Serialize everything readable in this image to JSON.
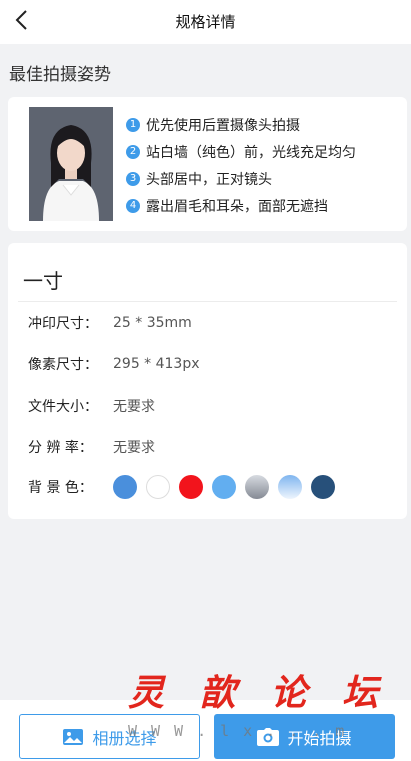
{
  "topbar": {
    "title": "规格详情",
    "back_icon": "chevron-left-icon"
  },
  "section": {
    "heading": "最佳拍摄姿势"
  },
  "tips": [
    {
      "num": "1",
      "text": "优先使用后置摄像头拍摄"
    },
    {
      "num": "2",
      "text": "站白墙（纯色）前，光线充足均匀"
    },
    {
      "num": "3",
      "text": "头部居中，正对镜头"
    },
    {
      "num": "4",
      "text": "露出眉毛和耳朵，面部无遮挡"
    }
  ],
  "spec": {
    "title": "一寸",
    "print_size_label": "冲印尺寸：",
    "print_size_value": "25 * 35mm",
    "pixel_size_label": "像素尺寸：",
    "pixel_size_value": "295 * 413px",
    "file_size_label": "文件大小：",
    "file_size_value": "无要求",
    "resolution_label": "分 辨 率：",
    "resolution_value": "无要求",
    "background_label": "背 景 色：",
    "background_colors": [
      "#4a8fdc",
      "#ffffff",
      "#f2141c",
      "#62aef0",
      "#858a94",
      "#7fb5ef",
      "#27507a"
    ]
  },
  "buttons": {
    "album_label": "相册选择",
    "album_icon": "image-icon",
    "shoot_label": "开始拍摄",
    "shoot_icon": "camera-icon"
  },
  "watermark": {
    "title_chars": [
      "灵",
      "歆",
      "论",
      "坛"
    ],
    "subtitle": "WWW.lx...m"
  },
  "colors": {
    "accent": "#3e9be9",
    "page_bg": "#f1f2f4"
  }
}
